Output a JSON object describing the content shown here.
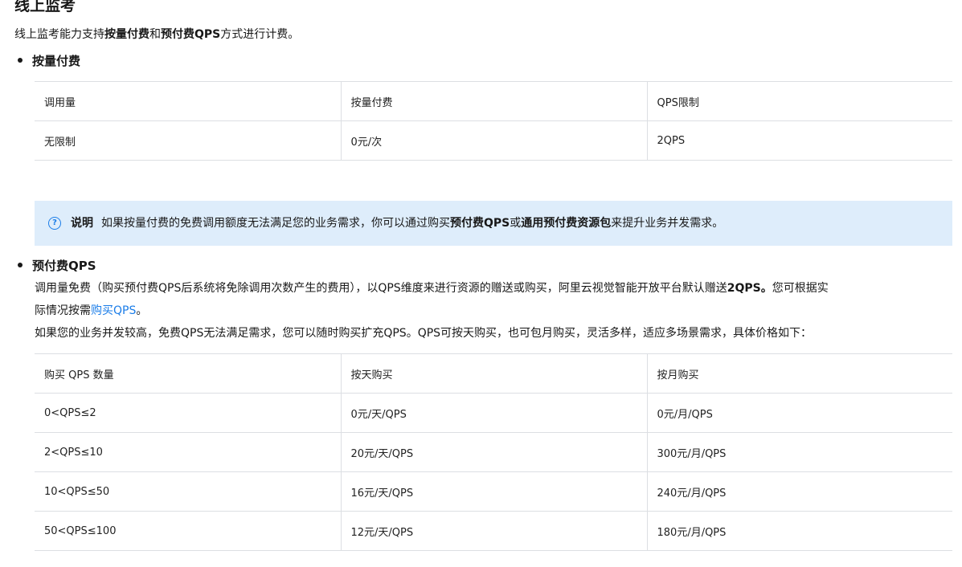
{
  "title": "线上监考",
  "intro": {
    "prefix": "线上监考能力支持",
    "bold1": "按量付费",
    "mid": "和",
    "bold2": "预付费QPS",
    "suffix": "方式进行计费。"
  },
  "section1": {
    "heading": "按量付费",
    "table": {
      "headers": [
        "调用量",
        "按量付费",
        "QPS限制"
      ],
      "rows": [
        [
          "无限制",
          "0元/次",
          "2QPS"
        ]
      ]
    }
  },
  "note": {
    "label": "说明",
    "prefix": "如果按量付费的免费调用额度无法满足您的业务需求，你可以通过购买",
    "bold1": "预付费QPS",
    "mid": "或",
    "bold2": "通用预付费资源包",
    "suffix": "来提升业务并发需求。"
  },
  "section2": {
    "heading": "预付费QPS",
    "line1_prefix": "调用量免费（购买预付费QPS后系统将免除调用次数产生的费用），以QPS维度来进行资源的赠送或购买，阿里云视觉智能开放平台默认赠送",
    "line1_bold": "2QPS。",
    "line1_suffix": "您可根据实",
    "line2_prefix": "际情况按需",
    "line2_link": "购买QPS",
    "line2_suffix": "。",
    "line3": "如果您的业务并发较高，免费QPS无法满足需求，您可以随时购买扩充QPS。QPS可按天购买，也可包月购买，灵活多样，适应多场景需求，具体价格如下：",
    "table": {
      "headers": [
        "购买 QPS 数量",
        "按天购买",
        "按月购买"
      ],
      "rows": [
        [
          "0<QPS≤2",
          "0元/天/QPS",
          "0元/月/QPS"
        ],
        [
          "2<QPS≤10",
          "20元/天/QPS",
          "300元/月/QPS"
        ],
        [
          "10<QPS≤50",
          "16元/天/QPS",
          "240元/月/QPS"
        ],
        [
          "50<QPS≤100",
          "12元/天/QPS",
          "180元/月/QPS"
        ]
      ]
    }
  },
  "colors": {
    "note_bg": "#deedfb",
    "link": "#1b7de8",
    "border": "#dcdfe3"
  },
  "icons": {
    "note": "question-circle-icon"
  }
}
